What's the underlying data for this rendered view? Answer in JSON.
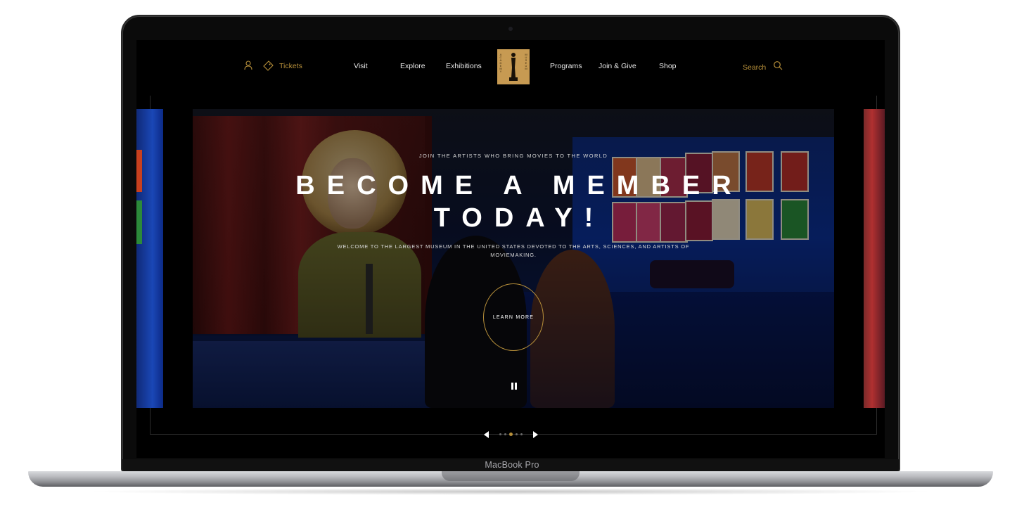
{
  "device": {
    "model_label": "MacBook Pro"
  },
  "nav": {
    "tickets_label": "Tickets",
    "items": [
      "Visit",
      "Explore",
      "Exhibitions",
      "Programs",
      "Join & Give",
      "Shop"
    ],
    "search_label": "Search",
    "logo_text": "ACADEMY MUSEUM",
    "accent_color": "#b8903a"
  },
  "hero": {
    "kicker": "JOIN THE ARTISTS WHO BRING MOVIES TO THE WORLD",
    "headline_line1": "BECOME A MEMBER",
    "headline_line2": "TODAY!",
    "subtitle": "WELCOME TO THE LARGEST MUSEUM IN THE UNITED STATES DEVOTED TO THE ARTS, SCIENCES, AND ARTISTS OF MOVIEMAKING.",
    "cta_label": "LEARN MORE"
  },
  "carousel": {
    "total_slides": 5,
    "active_slide": 3
  }
}
